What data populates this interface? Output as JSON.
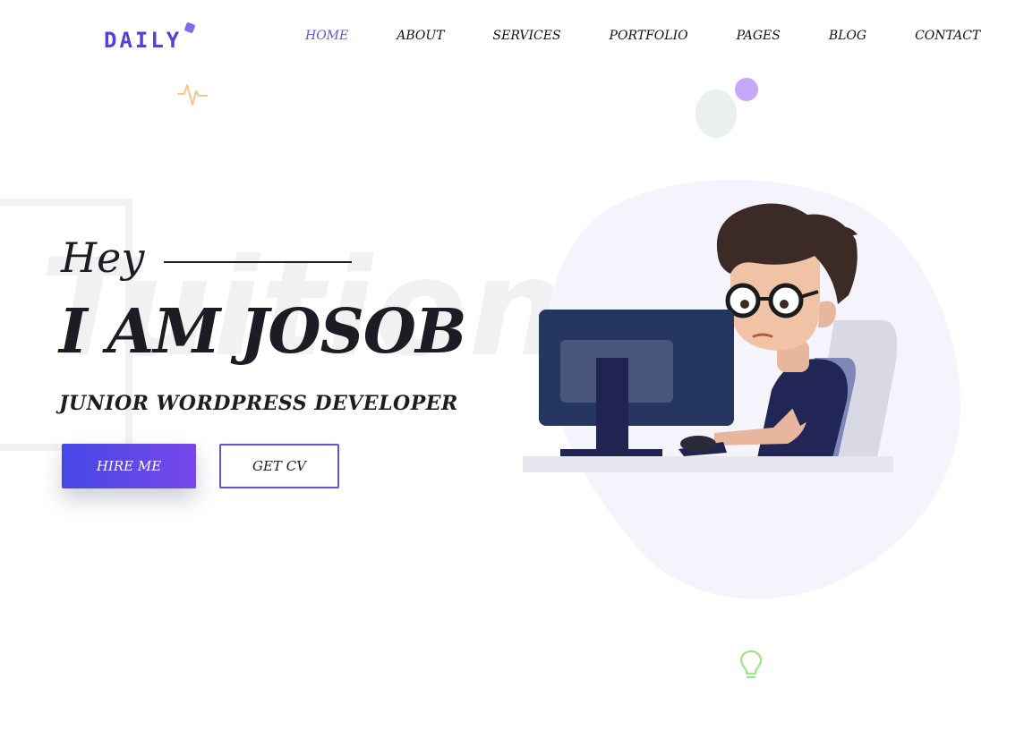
{
  "header": {
    "logo": "DAILY",
    "nav": [
      {
        "label": "HOME",
        "active": true
      },
      {
        "label": "ABOUT",
        "active": false
      },
      {
        "label": "SERVICES",
        "active": false
      },
      {
        "label": "PORTFOLIO",
        "active": false
      },
      {
        "label": "PAGES",
        "active": false
      },
      {
        "label": "BLOG",
        "active": false
      },
      {
        "label": "CONTACT",
        "active": false
      }
    ]
  },
  "hero": {
    "watermark": "Tuition",
    "greeting": "Hey",
    "name": "I AM JOSOB",
    "role": "JUNIOR WORDPRESS DEVELOPER",
    "hire_button": "HIRE ME",
    "cv_button": "GET CV"
  },
  "icons": {
    "pulse": "heartbeat-icon",
    "bulb": "lightbulb-icon"
  },
  "colors": {
    "accent": "#6a4ff0",
    "button_gradient_start": "#4548e6",
    "button_gradient_end": "#7847e8",
    "text": "#1c1c24",
    "blob": "#f5f4fc",
    "pulse_icon": "#f6c589",
    "bulb_icon": "#9ee58a"
  }
}
